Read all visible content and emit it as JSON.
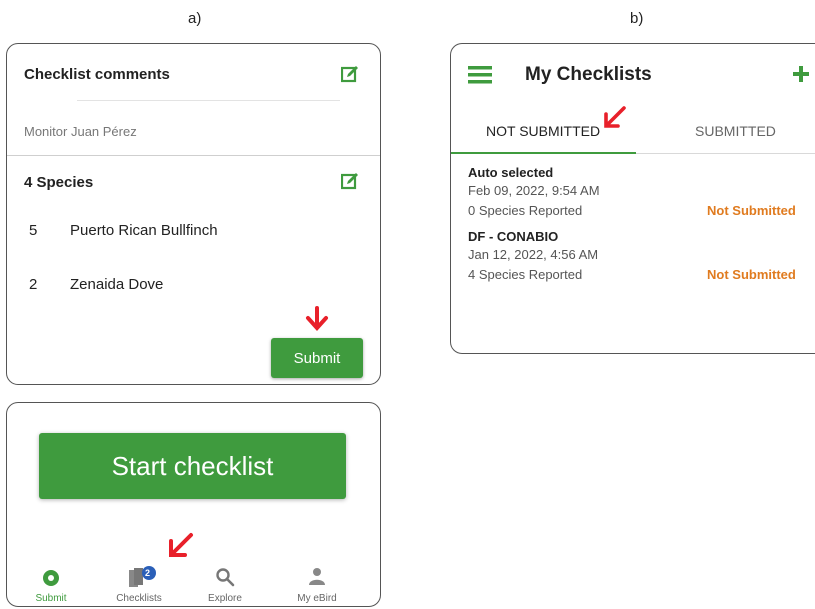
{
  "labels": {
    "a": "a)",
    "b": "b)"
  },
  "panel_a_top": {
    "comments_title": "Checklist comments",
    "comment_text": "Monitor Juan Pérez",
    "species_title": "4 Species",
    "species": [
      {
        "count": "5",
        "name": "Puerto Rican Bullfinch"
      },
      {
        "count": "2",
        "name": "Zenaida Dove"
      }
    ],
    "submit_label": "Submit"
  },
  "panel_a_bottom": {
    "start_label": "Start checklist",
    "nav": [
      {
        "label": "Submit"
      },
      {
        "label": "Checklists",
        "badge": "2"
      },
      {
        "label": "Explore"
      },
      {
        "label": "My eBird"
      }
    ]
  },
  "panel_b": {
    "title": "My Checklists",
    "tabs": {
      "not_submitted": "NOT SUBMITTED",
      "submitted": "SUBMITTED"
    },
    "items": [
      {
        "name": "Auto selected",
        "date": "Feb 09, 2022, 9:54 AM",
        "species": "0 Species Reported",
        "status": "Not Submitted"
      },
      {
        "name": "DF - CONABIO",
        "date": "Jan 12, 2022, 4:56 AM",
        "species": "4 Species Reported",
        "status": "Not Submitted"
      }
    ]
  },
  "colors": {
    "green": "#3f9b3e",
    "orange": "#e07b1f",
    "arrow_red": "#e8202a",
    "badge_blue": "#2a5fb8"
  }
}
